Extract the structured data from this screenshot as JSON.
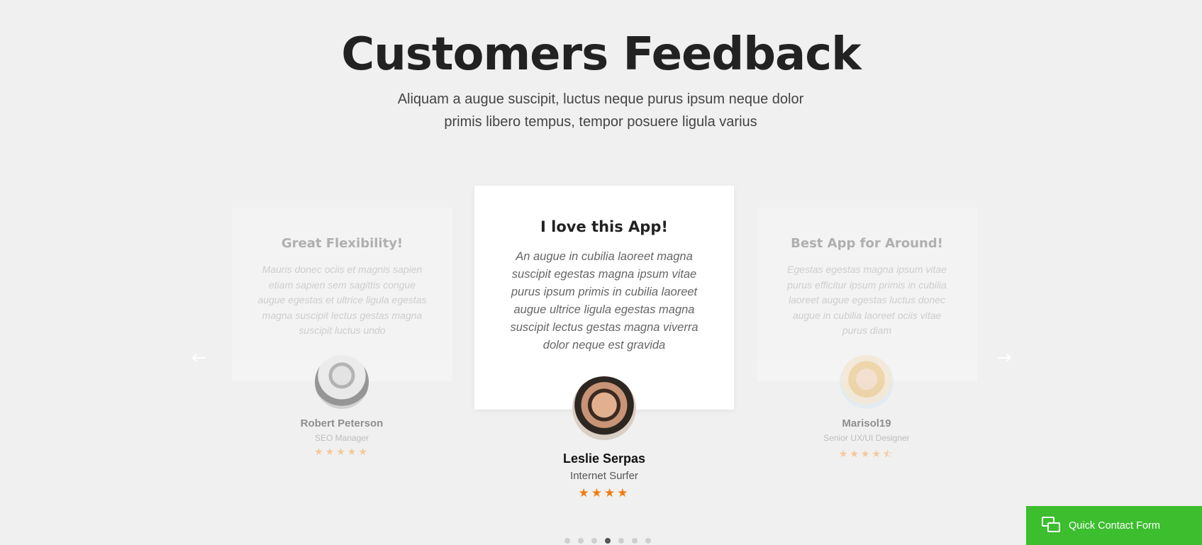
{
  "section": {
    "title": "Customers Feedback",
    "subtitle_line1": "Aliquam a augue suscipit, luctus neque purus ipsum neque dolor",
    "subtitle_line2": "primis libero tempus, tempor posuere ligula varius"
  },
  "carousel": {
    "prev_icon": "←",
    "next_icon": "→",
    "testimonials": [
      {
        "title": "Great Flexibility!",
        "text": "Mauris donec ociis et magnis sapien etiam sapien sem sagittis congue augue egestas et ultrice ligula egestas magna suscipit lectus gestas magna suscipit luctus undo",
        "name": "Robert Peterson",
        "role": "SEO Manager",
        "stars": "★★★★★",
        "rating": 5
      },
      {
        "title": "I love this App!",
        "text": "An augue in cubilia laoreet magna suscipit egestas magna ipsum vitae purus ipsum primis in cubilia laoreet augue ultrice ligula egestas magna suscipit lectus gestas magna viverra dolor neque est gravida",
        "name": "Leslie Serpas",
        "role": "Internet Surfer",
        "stars": "★★★★",
        "rating": 4
      },
      {
        "title": "Best App for Around!",
        "text": "Egestas egestas magna ipsum vitae purus efficitur ipsum primis in cubilia laoreet augue egestas luctus donec augue in cubilia laoreet ociis vitae purus diam",
        "name": "Marisol19",
        "role": "Senior UX/UI Designer",
        "stars": "★★★★⯪",
        "rating": 4.5
      }
    ],
    "page_count": 7,
    "active_page": 4
  },
  "contact": {
    "label": "Quick Contact Form",
    "icon": "chat-bubbles-icon"
  },
  "colors": {
    "background": "#f0f0f0",
    "star_active": "#f07d10",
    "contact_green": "#3cbe2e"
  }
}
